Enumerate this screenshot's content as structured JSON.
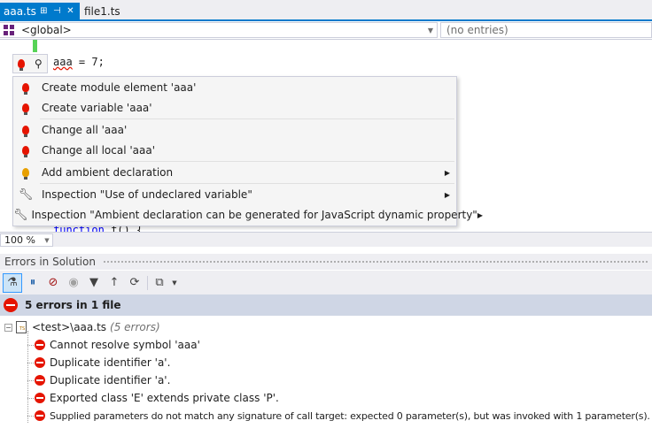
{
  "tabs": [
    {
      "label": "aaa.ts",
      "active": true
    },
    {
      "label": "file1.ts",
      "active": false
    }
  ],
  "navbar": {
    "scope": "<global>",
    "members": "(no entries)"
  },
  "editor": {
    "line1_ident": "aaa",
    "line1_rest": " = 7;",
    "line2_kw": "function",
    "line2_rest": " f() {"
  },
  "menu": {
    "items": [
      {
        "label": "Create module element 'aaa'",
        "icon": "red-bulb-icon",
        "submenu": false
      },
      {
        "label": "Create variable 'aaa'",
        "icon": "red-bulb-icon",
        "submenu": false
      },
      {
        "label": "Change all 'aaa'",
        "icon": "red-bulb-icon",
        "submenu": false
      },
      {
        "label": "Change all local 'aaa'",
        "icon": "red-bulb-icon",
        "submenu": false
      },
      {
        "label": "Add ambient declaration",
        "icon": "yellow-bulb-icon",
        "submenu": true
      },
      {
        "label": "Inspection \"Use of undeclared variable\"",
        "icon": "wrench-icon",
        "submenu": true
      },
      {
        "label": "Inspection \"Ambient declaration can be generated for JavaScript dynamic property\"",
        "icon": "wrench-icon",
        "submenu": true
      }
    ]
  },
  "zoom": {
    "value": "100 %"
  },
  "errors_window": {
    "title": "Errors in Solution",
    "summary": "5 errors in 1 file",
    "file": {
      "path": "<test>\\aaa.ts",
      "count": "(5 errors)"
    },
    "errors": [
      "Cannot resolve symbol 'aaa'",
      "Duplicate identifier 'a'.",
      "Duplicate identifier 'a'.",
      "Exported class 'E' extends private class 'P'.",
      "Supplied parameters do not match any signature of call target: expected 0 parameter(s), but was invoked with 1 parameter(s)."
    ]
  },
  "colors": {
    "accent": "#007acc",
    "error": "#e51400",
    "summary_bg": "#cfd6e5"
  }
}
